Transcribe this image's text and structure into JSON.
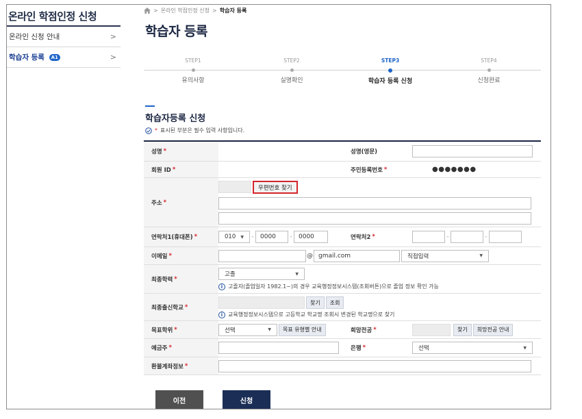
{
  "sidebar": {
    "title": "온라인 학점인정 신청",
    "items": [
      {
        "label": "온라인 신청 안내",
        "badge": "",
        "chevron": ">"
      },
      {
        "label": "학습자 등록",
        "badge": "A1",
        "chevron": ">"
      }
    ]
  },
  "breadcrumb": {
    "items": [
      "온라인 학점인정 신청",
      "학습자 등록"
    ],
    "separator": ">"
  },
  "page_title": "학습자 등록",
  "steps": [
    {
      "step": "STEP1",
      "name": "유의사항",
      "active": false
    },
    {
      "step": "STEP2",
      "name": "실명확인",
      "active": false
    },
    {
      "step": "STEP3",
      "name": "학습자 등록 신청",
      "active": true
    },
    {
      "step": "STEP4",
      "name": "신청완료",
      "active": false
    }
  ],
  "section": {
    "title": "학습자등록 신청",
    "required_star": "*",
    "required_note": "표시된 부분은 필수 입력 사항입니다."
  },
  "form": {
    "star": "*",
    "name_label": "성명",
    "name_value": "",
    "name_en_label": "성명(영문)",
    "name_en_value": "",
    "member_id_label": "회원 ID",
    "member_id_value": "",
    "rrn_label": "주민등록번호",
    "rrn_value": "●●●●●●●",
    "address_label": "주소",
    "zip_button": "우편번호 찾기",
    "address1_value": "",
    "address2_value": "",
    "phone1_label": "연락처1(휴대폰)",
    "phone1_prefix": "010",
    "phone1_mid": "0000",
    "phone1_last": "0000",
    "phone2_label": "연락처2",
    "dash": "-",
    "email_label": "이메일",
    "email_at": "@",
    "email_domain": "gmail.com",
    "email_select": "직접입력",
    "edu_label": "최종학력",
    "edu_value": "고졸",
    "edu_info": "고졸자(졸업일자 1982.1~)의 경우 교육행정정보시스템(조회버튼)으로 졸업 정보 확인 가능",
    "school_label": "최종출신학교",
    "school_find": "찾기",
    "school_lookup": "조회",
    "school_info": "교육행정정보시스템으로 고등학교 학교명 조회시 변경된 학교명으로 찾기",
    "degree_label": "목표학위",
    "degree_select": "선택",
    "degree_guide": "목표 유형별 안내",
    "major_label": "희망전공",
    "major_find": "찾기",
    "major_guide": "희망전공 안내",
    "holder_label": "예금주",
    "bank_label": "은행",
    "bank_select": "선택",
    "refund_label": "환불계좌정보"
  },
  "buttons": {
    "prev": "이전",
    "apply": "신청"
  },
  "colors": {
    "accent": "#1d64c9",
    "required": "#d3242b",
    "navy": "#1b2e56",
    "highlight_border": "#d3242b"
  }
}
